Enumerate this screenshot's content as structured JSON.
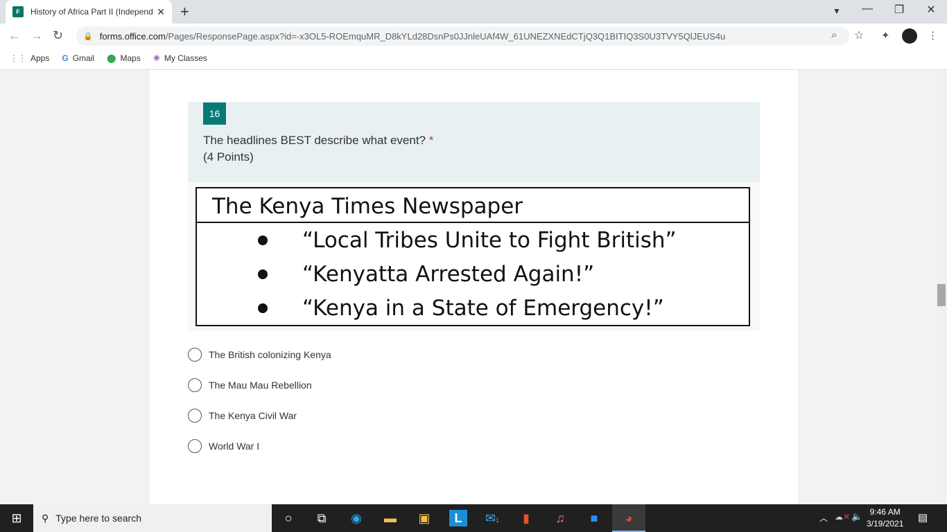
{
  "browser": {
    "tab_title": "History of Africa Part II (Independ",
    "url_host": "forms.office.com",
    "url_path": "/Pages/ResponsePage.aspx?id=-x3OL5-ROEmquMR_D8kYLd28DsnPs0JJnleUAf4W_61UNEZXNEdCTjQ3Q1BITIQ3S0U3TVY5QlJEUS4u",
    "bookmarks": [
      "Apps",
      "Gmail",
      "Maps",
      "My Classes"
    ]
  },
  "question": {
    "number": "16",
    "text": "The headlines BEST describe what event?",
    "required": "*",
    "points": "(4 Points)",
    "image": {
      "title": "The Kenya Times Newspaper",
      "headlines": [
        "“Local Tribes Unite to Fight British”",
        "“Kenyatta Arrested Again!”",
        "“Kenya in a State of Emergency!”"
      ]
    },
    "options": [
      "The British colonizing Kenya",
      "The Mau Mau Rebellion",
      "The Kenya Civil War",
      "World War I"
    ]
  },
  "taskbar": {
    "search_placeholder": "Type here to search",
    "time": "9:46 AM",
    "date": "3/19/2021",
    "mail_badge": "1"
  }
}
